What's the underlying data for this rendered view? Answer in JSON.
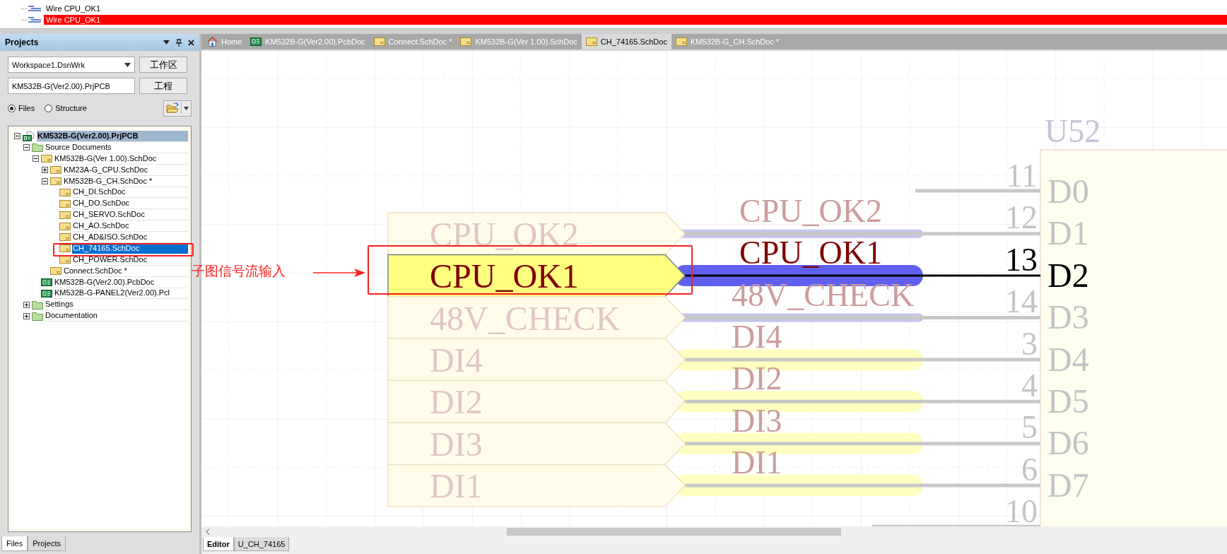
{
  "messages": [
    {
      "text": "Wire CPU_OK1",
      "selected": false
    },
    {
      "text": "Wire CPU_OK1",
      "selected": true
    }
  ],
  "projects_panel": {
    "title": "Projects",
    "workspace": "Workspace1.DsnWrk",
    "workspace_button": "工作区",
    "project": "KM532B-G(Ver2.00).PrjPCB",
    "project_button": "工程",
    "view_options": [
      {
        "label": "Files",
        "selected": true
      },
      {
        "label": "Structure",
        "selected": false
      }
    ],
    "tree": [
      {
        "label": "KM532B-G(Ver2.00).PrjPCB",
        "kind": "project",
        "expanded": true,
        "selected": false,
        "active": true,
        "children": [
          {
            "label": "Source Documents",
            "kind": "folder",
            "expanded": true,
            "selected": false,
            "children": [
              {
                "label": "KM532B-G(Ver 1.00).SchDoc",
                "kind": "sch",
                "expanded": true,
                "selected": false,
                "children": [
                  {
                    "label": "KM23A-G_CPU.SchDoc",
                    "kind": "sch",
                    "expanded": false,
                    "selected": false
                  },
                  {
                    "label": "KM532B-G_CH.SchDoc *",
                    "kind": "sch",
                    "expanded": true,
                    "selected": false,
                    "children": [
                      {
                        "label": "CH_DI.SchDoc",
                        "kind": "sch",
                        "selected": false
                      },
                      {
                        "label": "CH_DO.SchDoc",
                        "kind": "sch",
                        "selected": false
                      },
                      {
                        "label": "CH_SERVO.SchDoc",
                        "kind": "sch",
                        "selected": false
                      },
                      {
                        "label": "CH_AO.SchDoc",
                        "kind": "sch",
                        "selected": false
                      },
                      {
                        "label": "CH_AD&ISO.SchDoc",
                        "kind": "sch",
                        "selected": false
                      },
                      {
                        "label": "CH_74165.SchDoc",
                        "kind": "sch",
                        "selected": true
                      },
                      {
                        "label": "CH_POWER.SchDoc",
                        "kind": "sch",
                        "selected": false
                      }
                    ]
                  },
                  {
                    "label": "Connect.SchDoc *",
                    "kind": "sch",
                    "selected": false
                  }
                ]
              },
              {
                "label": "KM532B-G(Ver2.00).PcbDoc",
                "kind": "pcb",
                "selected": false
              },
              {
                "label": "KM532B-G-PANEL2(Ver2.00).Pcl",
                "kind": "pcb",
                "selected": false
              }
            ]
          },
          {
            "label": "Settings",
            "kind": "folder",
            "expanded": false,
            "selected": false
          },
          {
            "label": "Documentation",
            "kind": "folder",
            "expanded": false,
            "selected": false
          }
        ]
      }
    ],
    "bottom_tabs": [
      {
        "label": "Files",
        "selected": true
      },
      {
        "label": "Projects",
        "selected": false
      }
    ]
  },
  "document_tabs": [
    {
      "label": "Home",
      "kind": "home",
      "selected": false
    },
    {
      "label": "KM532B-G(Ver2.00).PcbDoc",
      "kind": "pcb",
      "selected": false
    },
    {
      "label": "Connect.SchDoc *",
      "kind": "sch",
      "selected": false
    },
    {
      "label": "KM532B-G(Ver 1.00).SchDoc",
      "kind": "sch",
      "selected": false
    },
    {
      "label": "CH_74165.SchDoc",
      "kind": "sch",
      "selected": true
    },
    {
      "label": "KM532B-G_CH.SchDoc *",
      "kind": "sch",
      "selected": false
    }
  ],
  "schematic": {
    "nets": [
      {
        "sheet_entry": "CPU_OK2",
        "net_label": "CPU_OK2",
        "selected": false,
        "color": "#c4c4ee",
        "kind": "line"
      },
      {
        "sheet_entry": "CPU_OK1",
        "net_label": "CPU_OK1",
        "selected": true,
        "color": "#6060f0",
        "kind": "band"
      },
      {
        "sheet_entry": "48V_CHECK",
        "net_label": "48V_CHECK",
        "selected": false,
        "color": "#c4c4ee",
        "kind": "line"
      },
      {
        "sheet_entry": "DI4",
        "net_label": "DI4",
        "selected": false,
        "color": "#ffffc0",
        "kind": "band"
      },
      {
        "sheet_entry": "DI2",
        "net_label": "DI2",
        "selected": false,
        "color": "#ffffc0",
        "kind": "band"
      },
      {
        "sheet_entry": "DI3",
        "net_label": "DI3",
        "selected": false,
        "color": "#ffffc0",
        "kind": "band"
      },
      {
        "sheet_entry": "DI1",
        "net_label": "DI1",
        "selected": false,
        "color": "#ffffc0",
        "kind": "band"
      }
    ],
    "designator": "U52",
    "pins": [
      {
        "number": "11",
        "name": "D0",
        "selected": false
      },
      {
        "number": "12",
        "name": "D1",
        "selected": false
      },
      {
        "number": "13",
        "name": "D2",
        "selected": true
      },
      {
        "number": "14",
        "name": "D3",
        "selected": false
      },
      {
        "number": "3",
        "name": "D4",
        "selected": false
      },
      {
        "number": "4",
        "name": "D5",
        "selected": false
      },
      {
        "number": "5",
        "name": "D6",
        "selected": false
      },
      {
        "number": "6",
        "name": "D7",
        "selected": false
      },
      {
        "number": "10",
        "selected": false
      }
    ]
  },
  "editor_tabs": [
    {
      "label": "Editor",
      "selected": true
    },
    {
      "label": "U_CH_74165",
      "selected": false
    }
  ],
  "annotation": {
    "text": "子图信号流输入"
  }
}
